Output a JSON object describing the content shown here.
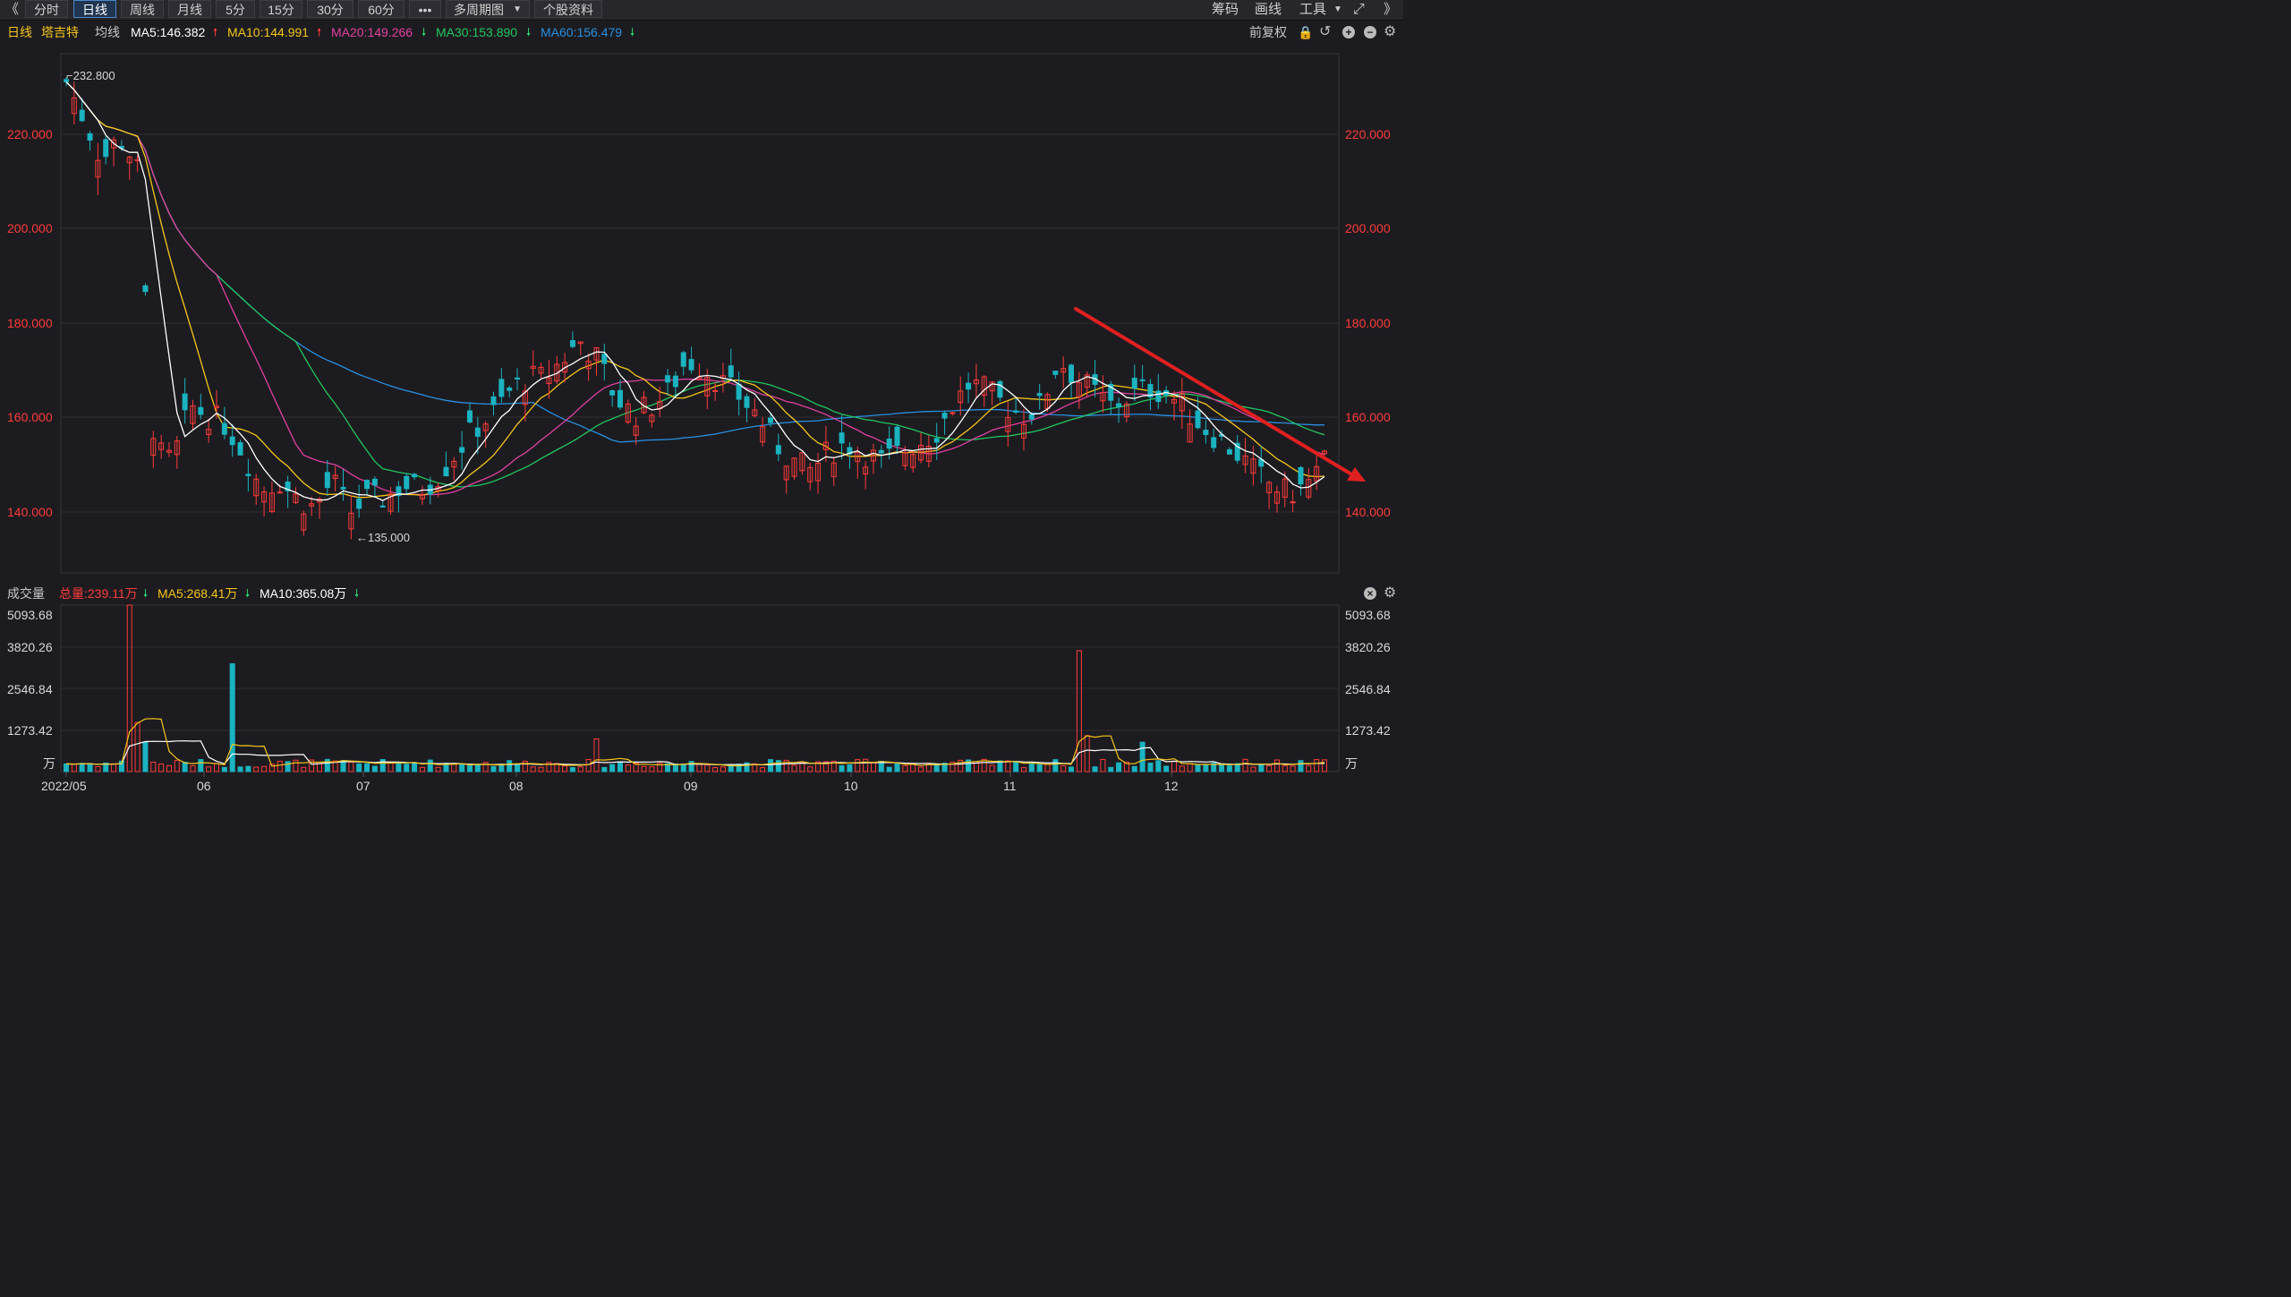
{
  "toolbar": {
    "left_arrow": "《",
    "tabs": [
      {
        "label": "分时",
        "active": false
      },
      {
        "label": "日线",
        "active": true
      },
      {
        "label": "周线",
        "active": false
      },
      {
        "label": "月线",
        "active": false
      },
      {
        "label": "5分",
        "active": false
      },
      {
        "label": "15分",
        "active": false
      },
      {
        "label": "30分",
        "active": false
      },
      {
        "label": "60分",
        "active": false
      },
      {
        "label": "•••",
        "active": false
      },
      {
        "label": "多周期图",
        "active": false
      },
      {
        "label": "个股资料",
        "active": false
      }
    ],
    "right_items": [
      "筹码",
      "画线",
      "工具"
    ],
    "right_arrow": "》"
  },
  "legend": {
    "period": "日线",
    "stock_name": "塔吉特",
    "ma_label": "均线",
    "ma5": "MA5:146.382",
    "ma10": "MA10:144.991",
    "ma20": "MA20:149.266",
    "ma30": "MA30:153.890",
    "ma60": "MA60:156.479",
    "adjust": "前复权",
    "colors": {
      "ma5": "#ffffff",
      "ma10": "#f5c518",
      "ma20": "#e040a0",
      "ma30": "#22c55e",
      "ma60": "#2a8fe0",
      "up": "#ff3a3a",
      "down": "#1bb3c0"
    }
  },
  "volume_legend": {
    "title": "成交量",
    "total": "总量:239.11万",
    "ma5": "MA5:268.41万",
    "ma10": "MA10:365.08万"
  },
  "chart_data": {
    "type": "candlestick",
    "price_axis": {
      "ticks": [
        "220.000",
        "200.000",
        "180.000",
        "160.000",
        "140.000"
      ],
      "ylim": [
        124,
        236
      ]
    },
    "volume_axis": {
      "ticks": [
        "5093.68",
        "3820.26",
        "2546.84",
        "1273.42"
      ],
      "unit": "万",
      "ylim": [
        0,
        5093.68
      ]
    },
    "x_labels": [
      "2022/05",
      "06",
      "07",
      "08",
      "09",
      "10",
      "11",
      "12"
    ],
    "annotations": {
      "high": "232.800",
      "low": "←135.000"
    },
    "trend_arrow_color": "#e02020",
    "ohlc_sketch_points": [
      [
        0,
        230
      ],
      [
        3,
        222
      ],
      [
        6,
        213
      ],
      [
        9,
        218
      ],
      [
        12,
        212
      ],
      [
        15,
        150
      ],
      [
        18,
        148
      ],
      [
        21,
        160
      ],
      [
        24,
        158
      ],
      [
        27,
        156
      ],
      [
        30,
        150
      ],
      [
        33,
        142
      ],
      [
        36,
        144
      ],
      [
        39,
        140
      ],
      [
        42,
        138
      ],
      [
        45,
        144
      ],
      [
        48,
        137
      ],
      [
        51,
        140
      ],
      [
        54,
        140
      ],
      [
        57,
        143
      ],
      [
        60,
        142
      ],
      [
        63,
        145
      ],
      [
        66,
        150
      ],
      [
        69,
        155
      ],
      [
        72,
        158
      ],
      [
        75,
        163
      ],
      [
        78,
        166
      ],
      [
        81,
        166
      ],
      [
        84,
        170
      ],
      [
        87,
        174
      ],
      [
        90,
        170
      ],
      [
        93,
        162
      ],
      [
        96,
        158
      ],
      [
        99,
        160
      ],
      [
        102,
        163
      ],
      [
        105,
        170
      ],
      [
        108,
        168
      ],
      [
        111,
        165
      ],
      [
        114,
        162
      ],
      [
        117,
        158
      ],
      [
        120,
        152
      ],
      [
        123,
        148
      ],
      [
        126,
        146
      ],
      [
        129,
        150
      ],
      [
        132,
        152
      ],
      [
        135,
        150
      ],
      [
        138,
        148
      ],
      [
        141,
        150
      ],
      [
        144,
        152
      ],
      [
        147,
        154
      ],
      [
        150,
        160
      ],
      [
        153,
        165
      ],
      [
        156,
        163
      ],
      [
        159,
        160
      ],
      [
        162,
        158
      ],
      [
        165,
        160
      ],
      [
        168,
        170
      ],
      [
        171,
        166
      ],
      [
        174,
        163
      ],
      [
        177,
        160
      ],
      [
        180,
        162
      ],
      [
        183,
        164
      ],
      [
        186,
        163
      ],
      [
        189,
        160
      ],
      [
        192,
        156
      ],
      [
        195,
        153
      ],
      [
        198,
        150
      ],
      [
        201,
        146
      ],
      [
        204,
        143
      ],
      [
        207,
        141
      ],
      [
        210,
        143
      ],
      [
        213,
        148
      ]
    ]
  }
}
